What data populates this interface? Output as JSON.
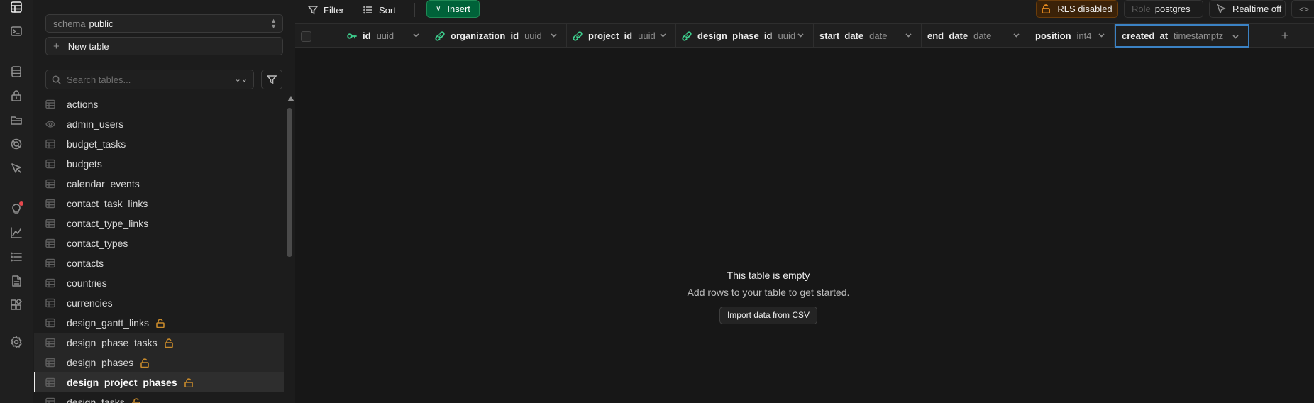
{
  "rail": {
    "icons": [
      "table-editor-icon",
      "sql-editor-icon",
      "database-icon",
      "auth-icon",
      "storage-icon",
      "edge-functions-icon",
      "realtime-icon",
      "advisors-icon",
      "reports-icon",
      "logs-icon",
      "api-docs-icon",
      "integrations-icon",
      "settings-icon"
    ]
  },
  "sidebar": {
    "schema_label": "schema",
    "schema_value": "public",
    "new_table_label": "New table",
    "search_placeholder": "Search tables...",
    "tables": [
      {
        "name": "actions",
        "type": "table",
        "locked": false
      },
      {
        "name": "admin_users",
        "type": "view",
        "locked": false
      },
      {
        "name": "budget_tasks",
        "type": "table",
        "locked": false
      },
      {
        "name": "budgets",
        "type": "table",
        "locked": false
      },
      {
        "name": "calendar_events",
        "type": "table",
        "locked": false
      },
      {
        "name": "contact_task_links",
        "type": "table",
        "locked": false
      },
      {
        "name": "contact_type_links",
        "type": "table",
        "locked": false
      },
      {
        "name": "contact_types",
        "type": "table",
        "locked": false
      },
      {
        "name": "contacts",
        "type": "table",
        "locked": false
      },
      {
        "name": "countries",
        "type": "table",
        "locked": false
      },
      {
        "name": "currencies",
        "type": "table",
        "locked": false
      },
      {
        "name": "design_gantt_links",
        "type": "table",
        "locked": true
      },
      {
        "name": "design_phase_tasks",
        "type": "table",
        "locked": true
      },
      {
        "name": "design_phases",
        "type": "table",
        "locked": true
      },
      {
        "name": "design_project_phases",
        "type": "table",
        "locked": true,
        "selected": true
      },
      {
        "name": "design_tasks",
        "type": "table",
        "locked": true
      }
    ]
  },
  "toolbar": {
    "filter_label": "Filter",
    "sort_label": "Sort",
    "insert_label": "Insert",
    "rls_label": "RLS disabled",
    "role_label": "Role",
    "role_value": "postgres",
    "realtime_label": "Realtime off",
    "code_label": "<>"
  },
  "columns": [
    {
      "name": "id",
      "type": "uuid",
      "icon": "key-icon"
    },
    {
      "name": "organization_id",
      "type": "uuid",
      "icon": "link-icon"
    },
    {
      "name": "project_id",
      "type": "uuid",
      "icon": "link-icon"
    },
    {
      "name": "design_phase_id",
      "type": "uuid",
      "icon": "link-icon"
    },
    {
      "name": "start_date",
      "type": "date",
      "icon": ""
    },
    {
      "name": "end_date",
      "type": "date",
      "icon": ""
    },
    {
      "name": "position",
      "type": "int4",
      "icon": ""
    },
    {
      "name": "created_at",
      "type": "timestamptz",
      "icon": "",
      "selected": true
    }
  ],
  "empty_state": {
    "title": "This table is empty",
    "subtitle": "Add rows to your table to get started.",
    "import_label": "Import data from CSV"
  },
  "colors": {
    "insert_bg": "#006239",
    "rls_bg": "#3b2208",
    "lock_amber": "#c88a2b",
    "key_green": "#3ecf8e",
    "selection_blue": "#3b82c4"
  }
}
